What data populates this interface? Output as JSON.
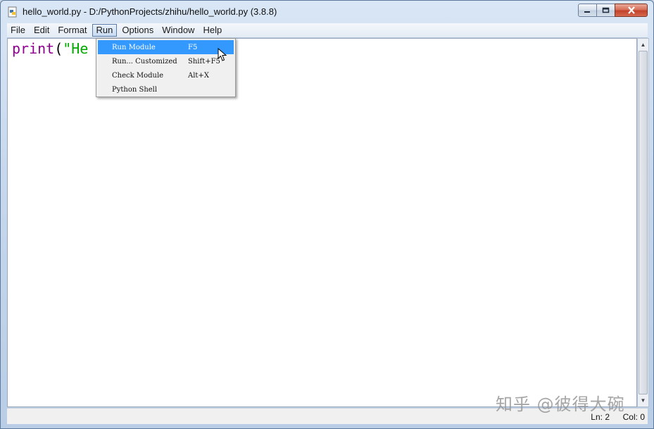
{
  "window": {
    "title": "hello_world.py - D:/PythonProjects/zhihu/hello_world.py (3.8.8)",
    "icon": "python-file-icon",
    "controls": {
      "minimize_icon": "minimize-icon",
      "maximize_icon": "maximize-icon",
      "close_icon": "close-icon"
    }
  },
  "menubar": {
    "items": [
      "File",
      "Edit",
      "Format",
      "Run",
      "Options",
      "Window",
      "Help"
    ],
    "active": "Run"
  },
  "editor": {
    "code": {
      "func": "print",
      "open_paren": "(",
      "string_start": "\"He"
    }
  },
  "run_menu": {
    "items": [
      {
        "label": "Run Module",
        "accel": "F5",
        "selected": true
      },
      {
        "label": "Run... Customized",
        "accel": "Shift+F5",
        "selected": false
      },
      {
        "label": "Check Module",
        "accel": "Alt+X",
        "selected": false
      },
      {
        "label": "Python Shell",
        "accel": "",
        "selected": false
      }
    ]
  },
  "status": {
    "line": "Ln: 2",
    "column": "Col: 0"
  },
  "watermark": "知乎 @彼得大碗",
  "colors": {
    "builtin": "#900090",
    "string": "#00aa00",
    "menu_highlight": "#3399ff"
  }
}
